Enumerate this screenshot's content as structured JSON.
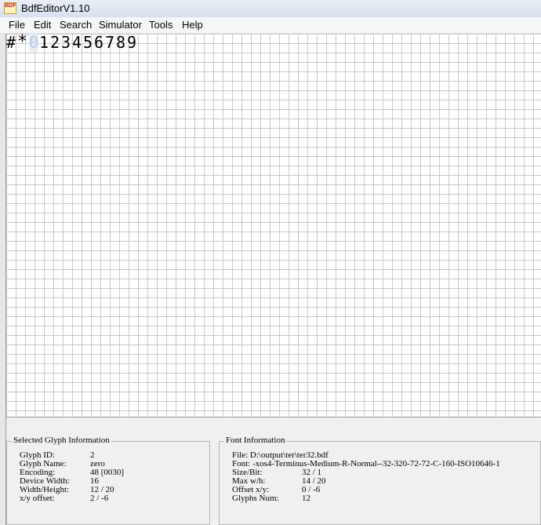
{
  "window": {
    "title": "BdfEditorV1.10",
    "icon_text": "BDF"
  },
  "menu": {
    "items": [
      "File",
      "Edit",
      "Search",
      "Simulator",
      "Tools",
      "Help"
    ]
  },
  "glyph_strip": {
    "glyphs": [
      "#",
      "*",
      "0",
      "1",
      "2",
      "3",
      "4",
      "5",
      "6",
      "7",
      "8",
      "9"
    ],
    "selected_index": 2
  },
  "selected_glyph": {
    "title": "Selected Glyph Information",
    "rows": [
      {
        "label": "Glyph ID:",
        "value": "2"
      },
      {
        "label": "Glyph Name:",
        "value": "zero"
      },
      {
        "label": "Encoding:",
        "value": "48 [0030]"
      },
      {
        "label": "Device Width:",
        "value": "16"
      },
      {
        "label": "Width/Height:",
        "value": "12 / 20"
      },
      {
        "label": "x/y offset:",
        "value": "2 / -6"
      }
    ]
  },
  "font_info": {
    "title": "Font Information",
    "file": "File: D:\\output\\ter\\ter32.bdf",
    "font": "Font: -xos4-Terminus-Medium-R-Normal--32-320-72-72-C-160-ISO10646-1",
    "rows": [
      {
        "label": "Size/Bit:",
        "value": "32 / 1"
      },
      {
        "label": "Max w/h:",
        "value": "14 / 20"
      },
      {
        "label": "Offset x/y:",
        "value": "0 / -6"
      },
      {
        "label": "Glyphs Num:",
        "value": "12"
      }
    ]
  }
}
